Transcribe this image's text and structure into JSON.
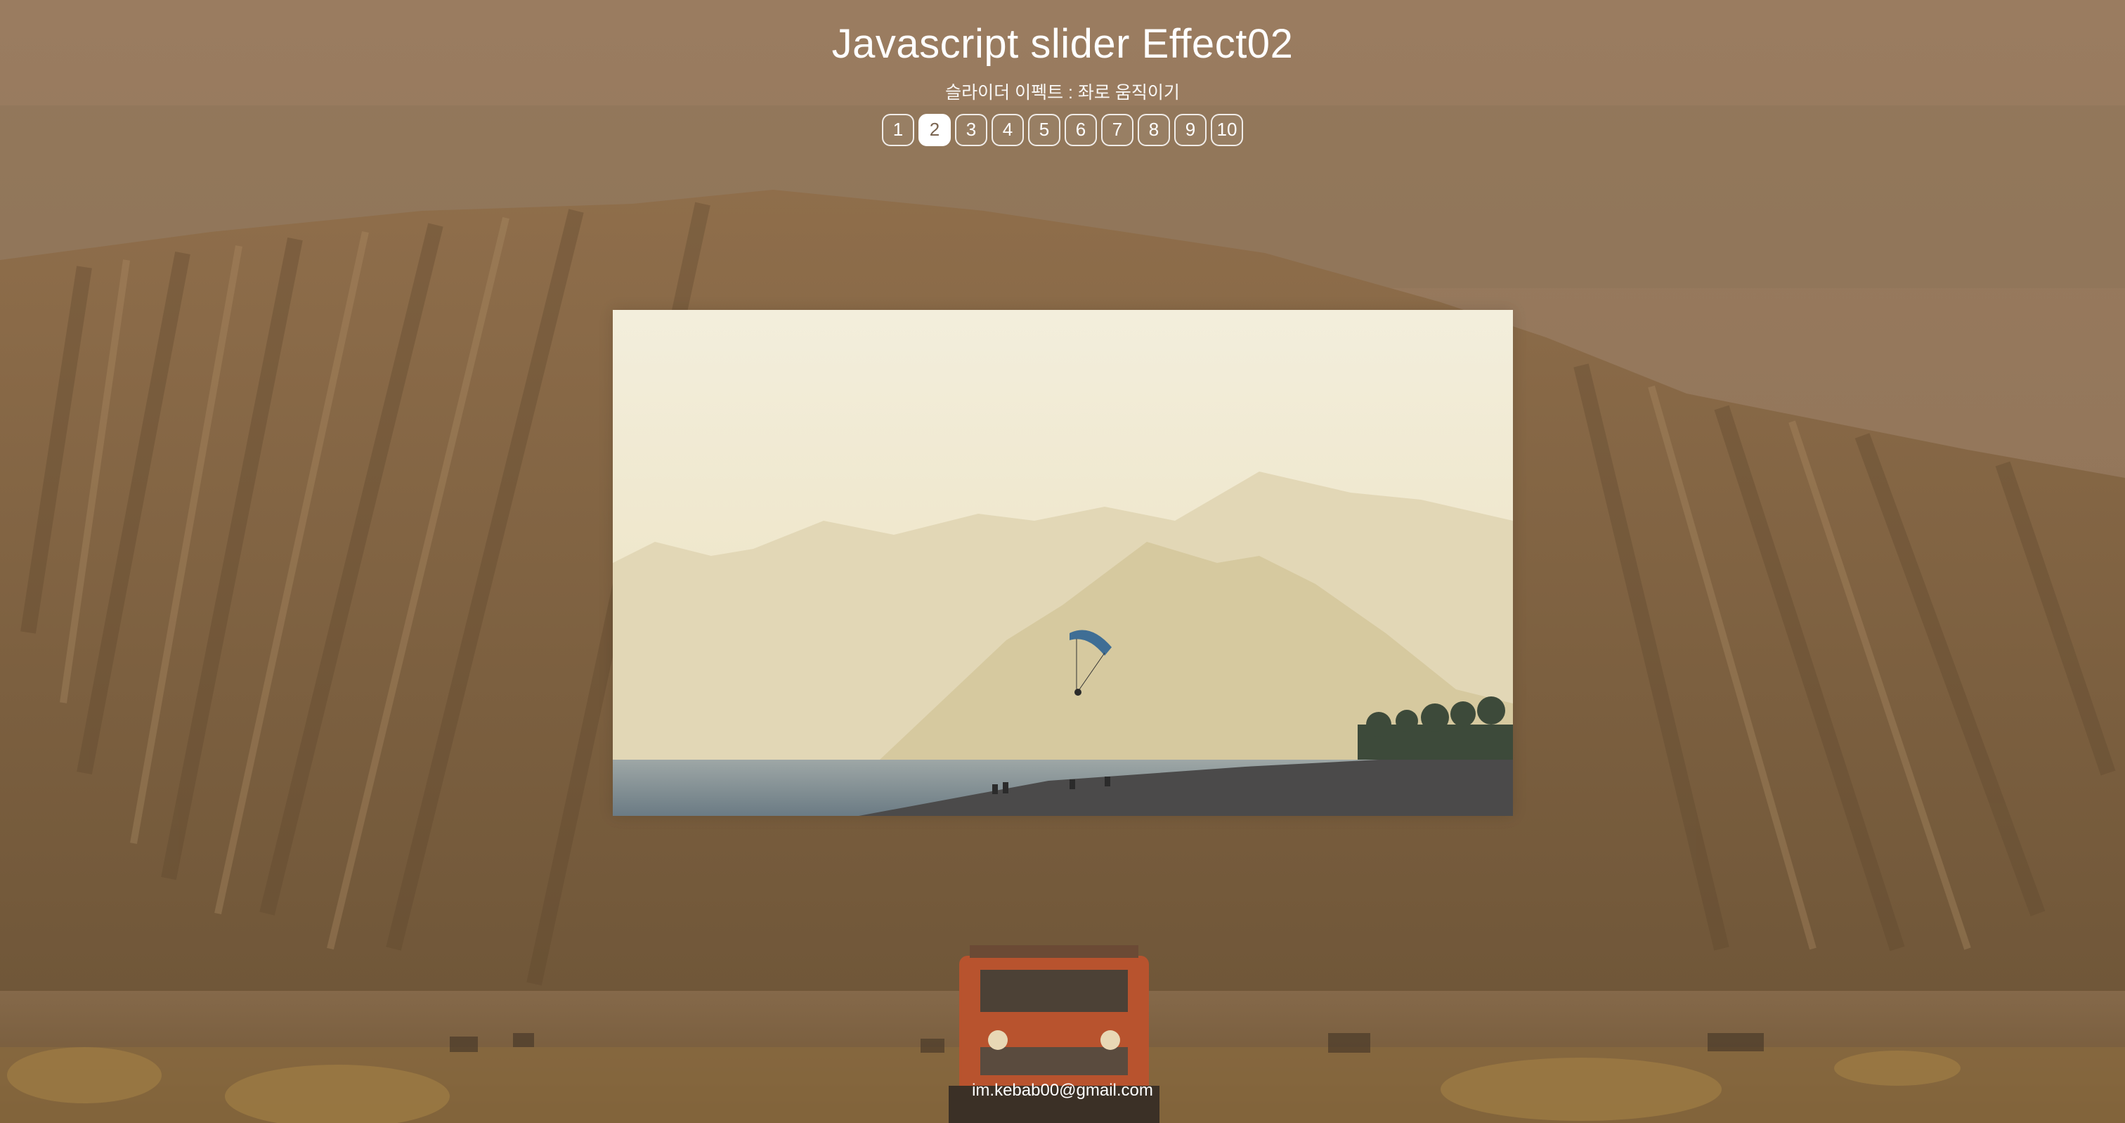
{
  "page": {
    "title": "Javascript slider Effect02",
    "subtitle": "슬라이더 이펙트 : 좌로 움직이기"
  },
  "pagination": {
    "pages": [
      "1",
      "2",
      "3",
      "4",
      "5",
      "6",
      "7",
      "8",
      "9",
      "10"
    ],
    "active_index": 1
  },
  "slider": {
    "current_slide": "paraglider over misty mountains and beach"
  },
  "background": {
    "description_icon": "desert-mountain-with-jeeps-image"
  },
  "footer": {
    "email": "im.kebab00@gmail.com"
  },
  "colors": {
    "accent": "#ffffff",
    "overlay": "#8a7055"
  }
}
